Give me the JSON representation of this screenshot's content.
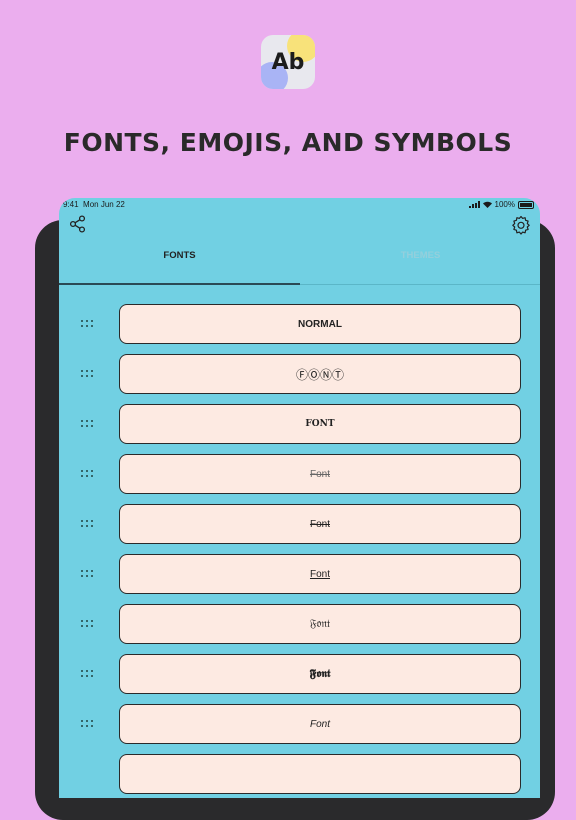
{
  "headline": "FONTS, EMOJIS, AND SYMBOLS",
  "app_icon": {
    "text": "Ab",
    "colors": {
      "yellow": "#f8e27a",
      "blue": "#a9b4f5",
      "base": "#e8e8ee"
    }
  },
  "status_bar": {
    "time": "9:41",
    "date": "Mon Jun 22",
    "battery": "100%"
  },
  "toolbar": {
    "share_icon": "share-icon",
    "settings_icon": "gear-icon"
  },
  "tabs": [
    {
      "label": "FONTS",
      "active": true
    },
    {
      "label": "THEMES",
      "active": false
    }
  ],
  "font_options": [
    {
      "label": "NORMAL"
    },
    {
      "label": "ⒻⓄⓃⓉ"
    },
    {
      "label": "FONT"
    },
    {
      "label": "Font"
    },
    {
      "label": "Font"
    },
    {
      "label": "Font"
    },
    {
      "label": "𝔉𝔬𝔫𝔱"
    },
    {
      "label": "𝕱𝖔𝖓𝖙"
    },
    {
      "label": "Font"
    }
  ],
  "colors": {
    "background": "#ebaeee",
    "screen": "#71d0e3",
    "option_bg": "#fdeae2"
  }
}
